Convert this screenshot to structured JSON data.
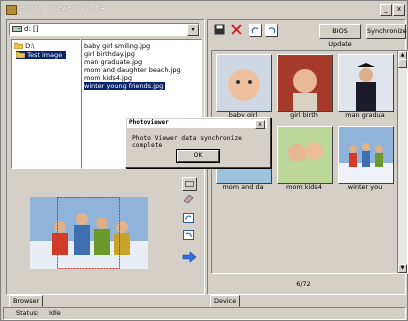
{
  "window": {
    "title": "Photo Viewer v2.04",
    "minimize": "_",
    "close": "x"
  },
  "drive": {
    "value": "d: []",
    "dropdown": "▾"
  },
  "folders": [
    {
      "label": "D:\\"
    },
    {
      "label": "Test image"
    }
  ],
  "files": [
    "baby girl smiling.jpg",
    "girl birthday.jpg",
    "man graduate.jpg",
    "mom and daughter beach.jpg",
    "mom kids4.jpg",
    "winter young friends.jpg"
  ],
  "right_toolbar": {
    "bios_label": "BIOS Update",
    "sync_label": "Synchronize"
  },
  "thumbnails": [
    {
      "caption": "baby girl"
    },
    {
      "caption": "girl birth"
    },
    {
      "caption": "man gradua"
    },
    {
      "caption": "mom and da"
    },
    {
      "caption": "mom kids4"
    },
    {
      "caption": "winter you"
    }
  ],
  "pager": {
    "text": "6/72"
  },
  "tabs": {
    "browser": "Browser",
    "device": "Device"
  },
  "status": {
    "label": "Status:",
    "value": "Idle"
  },
  "dialog": {
    "title": "Photoviewer",
    "close": "x",
    "message": "Photo Viewer data synchronize complete",
    "ok": "OK"
  },
  "colors": {
    "selection": "#0a246a",
    "face": "#d4d0c8"
  }
}
